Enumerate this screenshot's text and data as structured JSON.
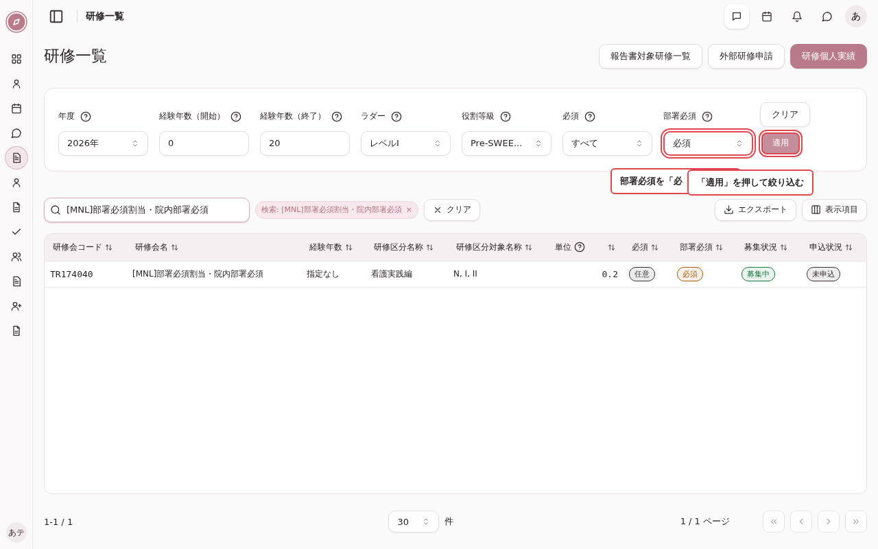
{
  "sidebar": {
    "avatar": "あテ",
    "items": [
      {
        "selected": false
      },
      {
        "selected": false
      },
      {
        "selected": false
      },
      {
        "selected": false
      },
      {
        "selected": true
      },
      {
        "selected": false
      },
      {
        "selected": false
      },
      {
        "selected": false
      },
      {
        "selected": false
      },
      {
        "selected": false
      },
      {
        "selected": false
      },
      {
        "selected": false
      }
    ]
  },
  "header": {
    "title": "研修一覧",
    "avatar": "あ"
  },
  "page": {
    "title": "研修一覧",
    "actions": [
      {
        "label": "報告書対象研修一覧",
        "primary": false
      },
      {
        "label": "外部研修申請",
        "primary": false
      },
      {
        "label": "研修個人実績",
        "primary": true
      }
    ]
  },
  "filters": [
    {
      "label": "年度",
      "kind": "select",
      "value": "2026年",
      "highlighted": false
    },
    {
      "label": "経験年数（開始）",
      "kind": "input",
      "value": "0",
      "highlighted": false
    },
    {
      "label": "経験年数（終了）",
      "kind": "input",
      "value": "20",
      "highlighted": false
    },
    {
      "label": "ラダー",
      "kind": "select",
      "value": "レベルI",
      "highlighted": false
    },
    {
      "label": "役割等級",
      "kind": "select",
      "value": "Pre-SWEE...",
      "highlighted": false
    },
    {
      "label": "必須",
      "kind": "select",
      "value": "すべて",
      "highlighted": false
    },
    {
      "label": "部署必須",
      "kind": "select",
      "value": "必須",
      "highlighted": true
    }
  ],
  "filter_buttons": {
    "clear": {
      "label": "クリア"
    },
    "apply": {
      "label": "適用",
      "highlighted": true
    }
  },
  "callouts": [
    {
      "text": "部署必須を「必"
    },
    {
      "text": "「適用」を押して絞り込む"
    }
  ],
  "search": {
    "value": "[MNL]部署必須割当・院内部署必須",
    "chip": "検索: [MNL]部署必須割当・院内部署必須",
    "chip_remove": "×",
    "clear": "クリア",
    "export": "エクスポート",
    "columns": "表示項目"
  },
  "table": {
    "columns": [
      {
        "label": "研修会コード",
        "kind": "plain"
      },
      {
        "label": "研修会名",
        "kind": "plain"
      },
      {
        "label": "経験年数",
        "kind": "plain"
      },
      {
        "label": "研修区分名称",
        "kind": "plain"
      },
      {
        "label": "研修区分対象名称",
        "kind": "plain"
      },
      {
        "label": "単位",
        "kind": "help"
      },
      {
        "label": "必須",
        "kind": "plain"
      },
      {
        "label": "部署必須",
        "kind": "plain"
      },
      {
        "label": "募集状況",
        "kind": "plain"
      },
      {
        "label": "申込状況",
        "kind": "plain"
      }
    ],
    "rows": [
      {
        "code": "TR174040",
        "name": "[MNL]部署必須割当・院内部署必須",
        "years": "指定なし",
        "category": "看護実践編",
        "target": "N, I, II",
        "unit": "0.2",
        "required": {
          "text": "任意",
          "color": "#3a3033"
        },
        "dept_required": {
          "text": "必須",
          "color": "#b25b00"
        },
        "recruitment": {
          "text": "募集中",
          "color": "#157a3c"
        },
        "application": {
          "text": "未申込",
          "color": "#3a3033"
        }
      }
    ]
  },
  "footer": {
    "range": "1-1 / 1",
    "page_size": "30",
    "page_size_unit": "件",
    "page_info": "1 / 1 ページ"
  }
}
